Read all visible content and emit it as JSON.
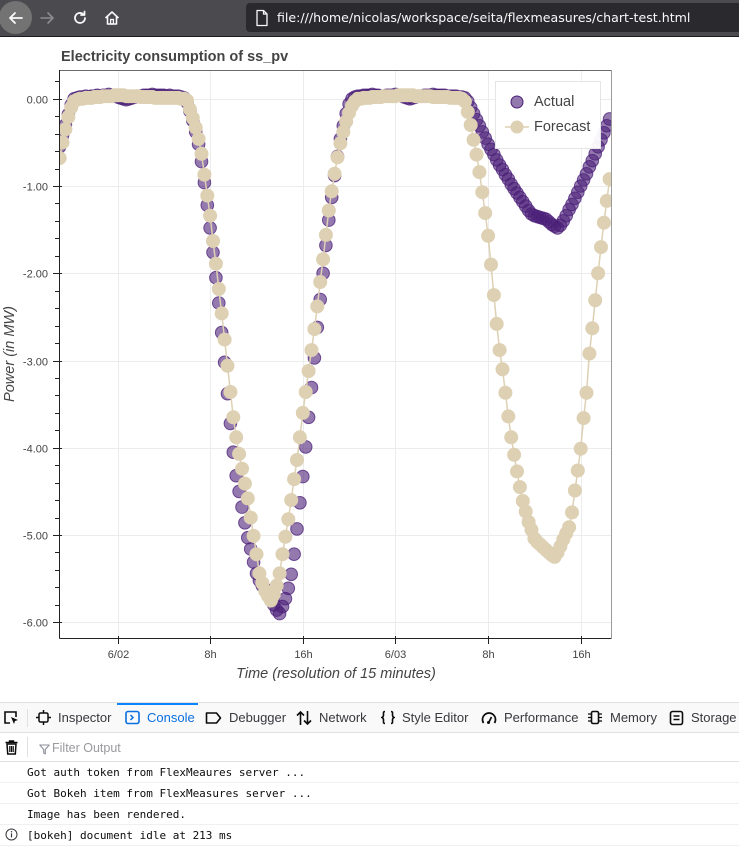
{
  "browser": {
    "url": "file:///home/nicolas/workspace/seita/flexmeasures/chart-test.html",
    "icons": {
      "back": "arrow-left-icon",
      "forward": "arrow-right-icon",
      "reload": "reload-icon",
      "home": "home-icon",
      "page": "page-icon"
    }
  },
  "chart_data": {
    "type": "scatter",
    "title": "Electricity consumption of ss_pv",
    "xlabel": "Time (resolution of 15 minutes)",
    "ylabel": "Power (in MW)",
    "x_start": "06-01 19:00",
    "x_step_minutes": 15,
    "xlim": [
      "06-01 19:02",
      "06-03 18:37"
    ],
    "ylim": [
      -6.18,
      0.33
    ],
    "xticks": [
      {
        "at": "06-02 00:00",
        "label": "6/02"
      },
      {
        "at": "06-02 08:00",
        "label": "8h"
      },
      {
        "at": "06-02 16:00",
        "label": "16h"
      },
      {
        "at": "06-03 00:00",
        "label": "6/03"
      },
      {
        "at": "06-03 08:00",
        "label": "8h"
      },
      {
        "at": "06-03 16:00",
        "label": "16h"
      }
    ],
    "yticks": [
      0,
      -1,
      -2,
      -3,
      -4,
      -5,
      -6
    ],
    "ytick_labels": [
      "0.00",
      "-1.00",
      "-2.00",
      "-3.00",
      "-4.00",
      "-5.00",
      "-6.00"
    ],
    "y_minor_step": 0.2,
    "grid": true,
    "legend": {
      "placement": "top-right"
    },
    "series": [
      {
        "name": "Actual",
        "mode": "markers",
        "color": "#4b1f78",
        "values": [
          -0.55,
          -0.42,
          -0.3,
          -0.18,
          -0.07,
          0.0,
          0.01,
          0.02,
          0.02,
          0.03,
          0.02,
          0.03,
          0.03,
          0.04,
          0.03,
          0.04,
          0.04,
          0.05,
          0.04,
          0.04,
          0.02,
          0.01,
          0.0,
          -0.01,
          0.0,
          0.01,
          0.02,
          0.03,
          0.03,
          0.04,
          0.04,
          0.04,
          0.05,
          0.04,
          0.04,
          0.04,
          0.04,
          0.03,
          0.04,
          0.03,
          0.03,
          0.03,
          0.02,
          0.01,
          -0.04,
          -0.14,
          -0.25,
          -0.38,
          -0.52,
          -0.72,
          -0.96,
          -1.22,
          -1.48,
          -1.76,
          -2.05,
          -2.34,
          -2.68,
          -3.02,
          -3.38,
          -3.72,
          -4.05,
          -4.32,
          -4.5,
          -4.68,
          -4.86,
          -5.03,
          -5.16,
          -5.31,
          -5.44,
          -5.52,
          -5.58,
          -5.62,
          -5.66,
          -5.72,
          -5.8,
          -5.86,
          -5.9,
          -5.82,
          -5.73,
          -5.61,
          -5.45,
          -5.22,
          -4.93,
          -4.63,
          -4.33,
          -3.99,
          -3.65,
          -3.31,
          -2.97,
          -2.62,
          -2.3,
          -2.0,
          -1.68,
          -1.39,
          -1.13,
          -0.88,
          -0.66,
          -0.46,
          -0.31,
          -0.17,
          -0.06,
          0.0,
          0.02,
          0.03,
          0.03,
          0.04,
          0.04,
          0.04,
          0.05,
          0.04,
          0.04,
          0.03,
          0.03,
          0.04,
          0.04,
          0.04,
          0.05,
          0.04,
          0.04,
          0.02,
          0.01,
          0.0,
          0.01,
          0.02,
          0.03,
          0.03,
          0.04,
          0.04,
          0.04,
          0.05,
          0.04,
          0.04,
          0.04,
          0.04,
          0.03,
          0.03,
          0.03,
          0.03,
          0.02,
          0.02,
          0.01,
          -0.03,
          -0.1,
          -0.17,
          -0.24,
          -0.31,
          -0.38,
          -0.45,
          -0.52,
          -0.58,
          -0.64,
          -0.7,
          -0.76,
          -0.81,
          -0.87,
          -0.92,
          -0.98,
          -1.03,
          -1.08,
          -1.13,
          -1.18,
          -1.23,
          -1.28,
          -1.32,
          -1.34,
          -1.35,
          -1.36,
          -1.37,
          -1.38,
          -1.41,
          -1.44,
          -1.46,
          -1.48,
          -1.45,
          -1.4,
          -1.34,
          -1.27,
          -1.21,
          -1.14,
          -1.07,
          -1.0,
          -0.93,
          -0.86,
          -0.78,
          -0.71,
          -0.63,
          -0.55,
          -0.47,
          -0.39,
          -0.31,
          -0.23
        ]
      },
      {
        "name": "Forecast",
        "mode": "lines+markers",
        "color": "#ddd0b3",
        "values": [
          -0.68,
          -0.5,
          -0.35,
          -0.21,
          -0.1,
          -0.03,
          -0.01,
          0.0,
          0.0,
          0.01,
          0.01,
          0.01,
          0.02,
          0.02,
          0.02,
          0.03,
          0.03,
          0.03,
          0.03,
          0.04,
          0.04,
          0.04,
          0.04,
          0.03,
          0.03,
          0.03,
          0.03,
          0.03,
          0.02,
          0.02,
          0.02,
          0.02,
          0.02,
          0.01,
          0.01,
          0.01,
          0.01,
          0.01,
          0.01,
          0.01,
          0.01,
          0.01,
          0.0,
          0.0,
          -0.02,
          -0.12,
          -0.22,
          -0.33,
          -0.46,
          -0.63,
          -0.87,
          -1.11,
          -1.34,
          -1.63,
          -1.89,
          -2.18,
          -2.46,
          -2.76,
          -3.06,
          -3.36,
          -3.65,
          -3.88,
          -4.07,
          -4.24,
          -4.41,
          -4.58,
          -4.8,
          -5.01,
          -5.22,
          -5.44,
          -5.55,
          -5.64,
          -5.7,
          -5.75,
          -5.68,
          -5.58,
          -5.44,
          -5.22,
          -5.02,
          -4.82,
          -4.6,
          -4.36,
          -4.14,
          -3.88,
          -3.6,
          -3.36,
          -3.12,
          -2.88,
          -2.64,
          -2.38,
          -2.1,
          -1.84,
          -1.56,
          -1.28,
          -1.06,
          -0.86,
          -0.67,
          -0.51,
          -0.38,
          -0.26,
          -0.16,
          -0.08,
          -0.03,
          0.0,
          0.0,
          0.01,
          0.01,
          0.01,
          0.02,
          0.02,
          0.02,
          0.02,
          0.03,
          0.03,
          0.03,
          0.03,
          0.03,
          0.04,
          0.04,
          0.04,
          0.04,
          0.04,
          0.04,
          0.03,
          0.03,
          0.03,
          0.03,
          0.03,
          0.03,
          0.02,
          0.02,
          0.02,
          0.02,
          0.02,
          0.02,
          0.01,
          0.01,
          0.01,
          0.01,
          0.0,
          -0.03,
          -0.15,
          -0.3,
          -0.47,
          -0.64,
          -0.84,
          -1.07,
          -1.31,
          -1.57,
          -1.9,
          -2.25,
          -2.58,
          -2.88,
          -3.1,
          -3.37,
          -3.64,
          -3.88,
          -4.08,
          -4.27,
          -4.45,
          -4.61,
          -4.73,
          -4.85,
          -4.94,
          -5.04,
          -5.08,
          -5.11,
          -5.14,
          -5.17,
          -5.2,
          -5.23,
          -5.25,
          -5.2,
          -5.13,
          -5.05,
          -4.98,
          -4.91,
          -4.74,
          -4.49,
          -4.26,
          -4.01,
          -3.66,
          -3.37,
          -2.92,
          -2.63,
          -2.31,
          -2.0,
          -1.7,
          -1.42,
          -1.17,
          -0.92
        ]
      }
    ]
  },
  "devtools": {
    "picker_icon": "element-picker-icon",
    "tabs": [
      {
        "label": "Inspector",
        "icon": "inspector-icon",
        "selected": false
      },
      {
        "label": "Console",
        "icon": "console-icon",
        "selected": true
      },
      {
        "label": "Debugger",
        "icon": "debugger-icon",
        "selected": false
      },
      {
        "label": "Network",
        "icon": "network-icon",
        "selected": false
      },
      {
        "label": "Style Editor",
        "icon": "style-editor-icon",
        "selected": false
      },
      {
        "label": "Performance",
        "icon": "performance-icon",
        "selected": false
      },
      {
        "label": "Memory",
        "icon": "memory-icon",
        "selected": false
      },
      {
        "label": "Storage",
        "icon": "storage-icon",
        "selected": false
      }
    ],
    "accent_color": "#0a84ff",
    "filter": {
      "placeholder": "Filter Output",
      "value": ""
    },
    "console_messages": [
      {
        "text": "Got auth token from FlexMeaures server ...",
        "level": "log"
      },
      {
        "text": "Got Bokeh item from FlexMeasures server ...",
        "level": "log"
      },
      {
        "text": "Image has been rendered.",
        "level": "log"
      },
      {
        "text": "[bokeh] document idle at 213 ms",
        "level": "info"
      }
    ]
  }
}
